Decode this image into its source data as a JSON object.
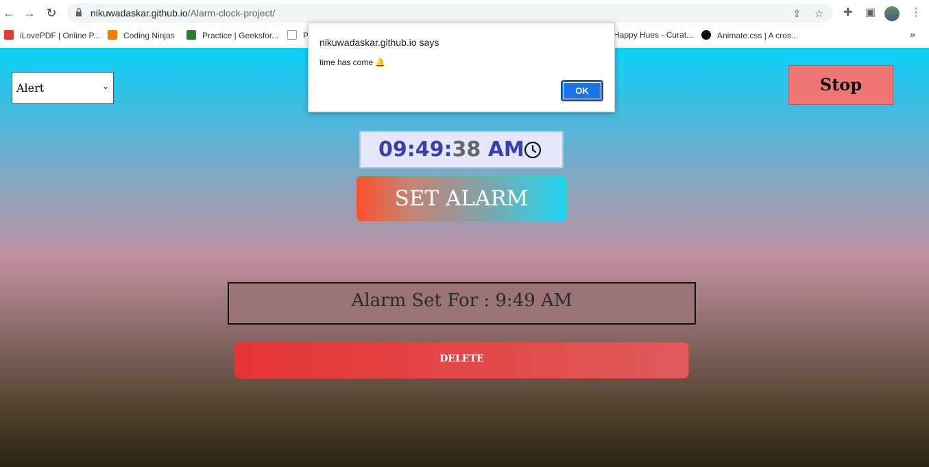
{
  "browser": {
    "url_host": "nikuwadaskar.github.io",
    "url_path": "/Alarm-clock-project/",
    "bookmarks": [
      {
        "label": "iLovePDF | Online P...",
        "color": "#e53935"
      },
      {
        "label": "Coding Ninjas",
        "color": "#f57c00"
      },
      {
        "label": "Practice | Geeksfor...",
        "color": "#2e7d32"
      },
      {
        "label": "P",
        "color": "#333333"
      },
      {
        "label": "Happy Hues - Curat...",
        "color": "#ffffff"
      },
      {
        "label": "Animate.css | A cros...",
        "color": "#111111"
      }
    ]
  },
  "dialog": {
    "title": "nikuwadaskar.github.io says",
    "message": "time has come 🔔",
    "ok_label": "OK"
  },
  "page": {
    "select_value": "Alert",
    "stop_label": "Stop",
    "clock_main": "09:49:",
    "clock_seconds": "38",
    "clock_ampm": " AM",
    "set_alarm_label": "SET ALARM",
    "alarm_text": "Alarm Set For : 9:49 AM",
    "delete_label": "DELETE"
  }
}
